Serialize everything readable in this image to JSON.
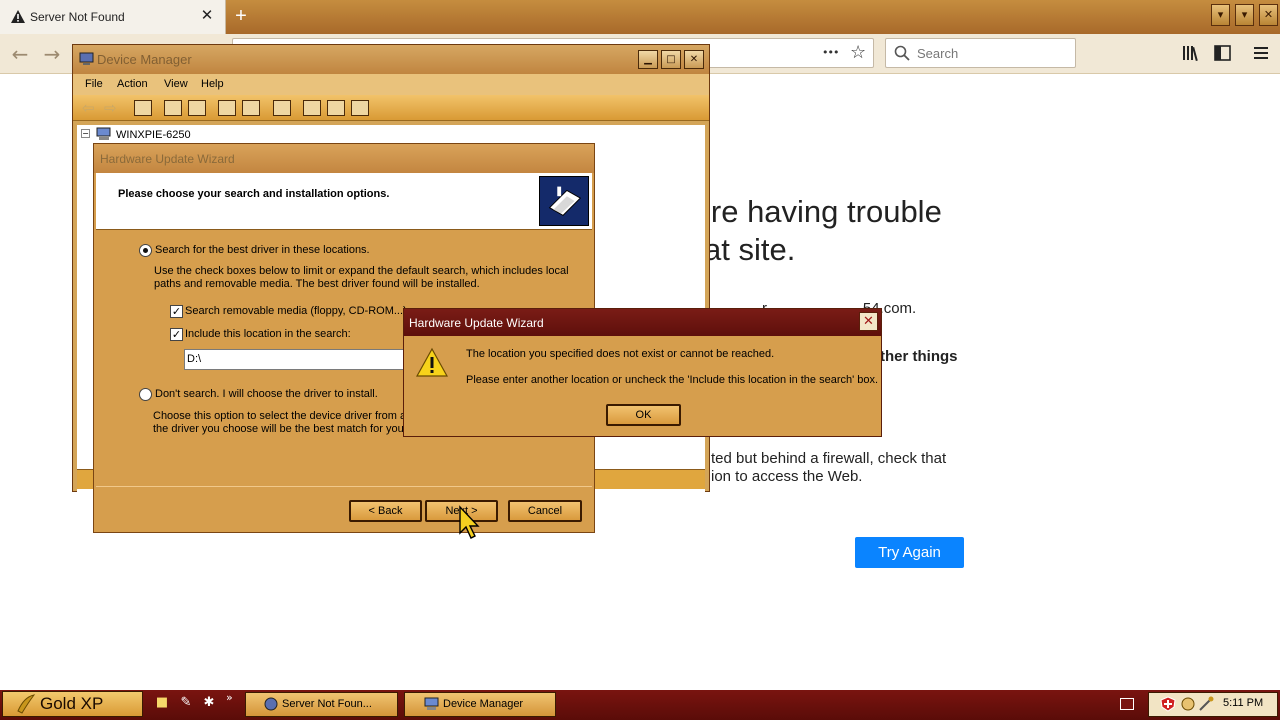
{
  "browser": {
    "tab_title": "Server Not Found",
    "tab_close": "✕",
    "new_tab": "+",
    "search_placeholder": "Search",
    "more_dots": "•••",
    "star": "☆"
  },
  "error_page": {
    "title_line1": "’re having trouble",
    "title_line2": "at site.",
    "line_domain": "r   . . . . . . . . . . . 54.com.",
    "other_things": "ther things",
    "firewall_line1": "ted but behind a firewall, check that",
    "firewall_line2": "ion to access the Web.",
    "try_again": "Try Again"
  },
  "device_manager": {
    "title": "Device Manager",
    "menu": [
      "File",
      "Action",
      "View",
      "Help"
    ],
    "tree_root": "WINXPIE-6250"
  },
  "wizard": {
    "title": "Hardware Update Wizard",
    "heading": "Please choose your search and installation options.",
    "option1": "Search for the best driver in these locations.",
    "option1_desc1": "Use the check boxes below to limit or expand the default search, which includes local",
    "option1_desc2": "paths and removable media. The best driver found will be installed.",
    "check1": "Search removable media (floppy, CD-ROM...)",
    "check2": "Include this location in the search:",
    "path_value": "D:\\",
    "option2": "Don't search. I will choose the driver to install.",
    "option2_desc1": "Choose this option to select the device driver from a l",
    "option2_desc2": "the driver you choose will be the best match for your",
    "back": "< Back",
    "next": "Next >",
    "cancel": "Cancel"
  },
  "alert": {
    "title": "Hardware Update Wizard",
    "message1": "The location you specified does not exist or cannot be reached.",
    "message2": "Please enter another location or uncheck the 'Include this location in the search' box.",
    "ok": "OK",
    "close": "✕"
  },
  "taskbar": {
    "start_label": "Gold XP",
    "tasks": [
      "Server Not Foun...",
      "Device Manager"
    ],
    "clock": "5:11 PM",
    "chevron": "»"
  },
  "colors": {
    "accent_blue": "#0a84ff",
    "alert_title": "#6a1410",
    "theme_gold": "#d69e4d"
  }
}
